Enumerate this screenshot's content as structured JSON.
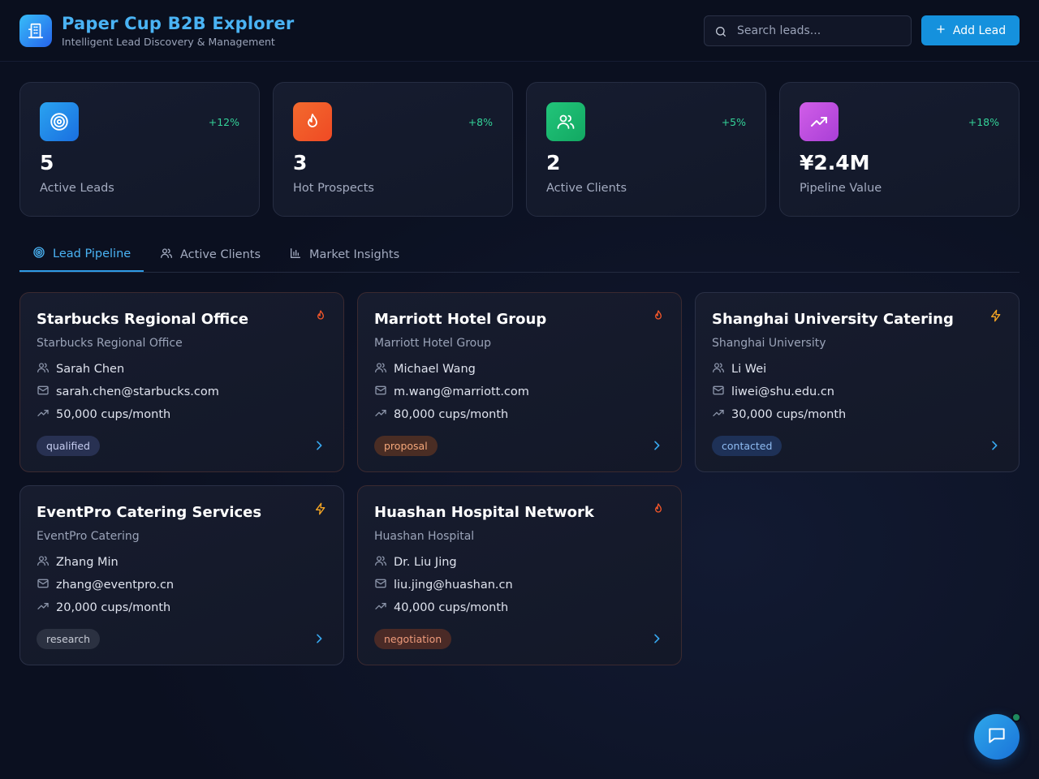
{
  "header": {
    "title": "Paper Cup B2B Explorer",
    "subtitle": "Intelligent Lead Discovery & Management",
    "search_placeholder": "Search leads...",
    "add_label": "Add Lead"
  },
  "stats": [
    {
      "value": "5",
      "label": "Active Leads",
      "delta": "+12%",
      "icon": "target-icon",
      "color": "#1e90e8"
    },
    {
      "value": "3",
      "label": "Hot Prospects",
      "delta": "+8%",
      "icon": "flame-icon",
      "color": "#f2562a"
    },
    {
      "value": "2",
      "label": "Active Clients",
      "delta": "+5%",
      "icon": "users-icon",
      "color": "#1fbf6e"
    },
    {
      "value": "¥2.4M",
      "label": "Pipeline Value",
      "delta": "+18%",
      "icon": "trending-up-icon",
      "color": "#c14fe0"
    }
  ],
  "tabs": [
    {
      "label": "Lead Pipeline",
      "icon": "target-icon",
      "active": true
    },
    {
      "label": "Active Clients",
      "icon": "users-icon",
      "active": false
    },
    {
      "label": "Market Insights",
      "icon": "bar-chart-icon",
      "active": false
    }
  ],
  "leads": [
    {
      "title": "Starbucks Regional Office",
      "company": "Starbucks Regional Office",
      "contact": "Sarah Chen",
      "email": "sarah.chen@starbucks.com",
      "volume": "50,000 cups/month",
      "status": "qualified",
      "priority_icon": "flame-icon"
    },
    {
      "title": "Marriott Hotel Group",
      "company": "Marriott Hotel Group",
      "contact": "Michael Wang",
      "email": "m.wang@marriott.com",
      "volume": "80,000 cups/month",
      "status": "proposal",
      "priority_icon": "flame-icon"
    },
    {
      "title": "Shanghai University Catering",
      "company": "Shanghai University",
      "contact": "Li Wei",
      "email": "liwei@shu.edu.cn",
      "volume": "30,000 cups/month",
      "status": "contacted",
      "priority_icon": "zap-icon"
    },
    {
      "title": "EventPro Catering Services",
      "company": "EventPro Catering",
      "contact": "Zhang Min",
      "email": "zhang@eventpro.cn",
      "volume": "20,000 cups/month",
      "status": "research",
      "priority_icon": "zap-icon"
    },
    {
      "title": "Huashan Hospital Network",
      "company": "Huashan Hospital",
      "contact": "Dr. Liu Jing",
      "email": "liu.jing@huashan.cn",
      "volume": "40,000 cups/month",
      "status": "negotiation",
      "priority_icon": "flame-icon"
    }
  ],
  "colors": {
    "accent": "#4ab3f4",
    "button": "#1591dd",
    "positive": "#34d399",
    "hot": "#f2562a",
    "warm": "#f5a524"
  }
}
